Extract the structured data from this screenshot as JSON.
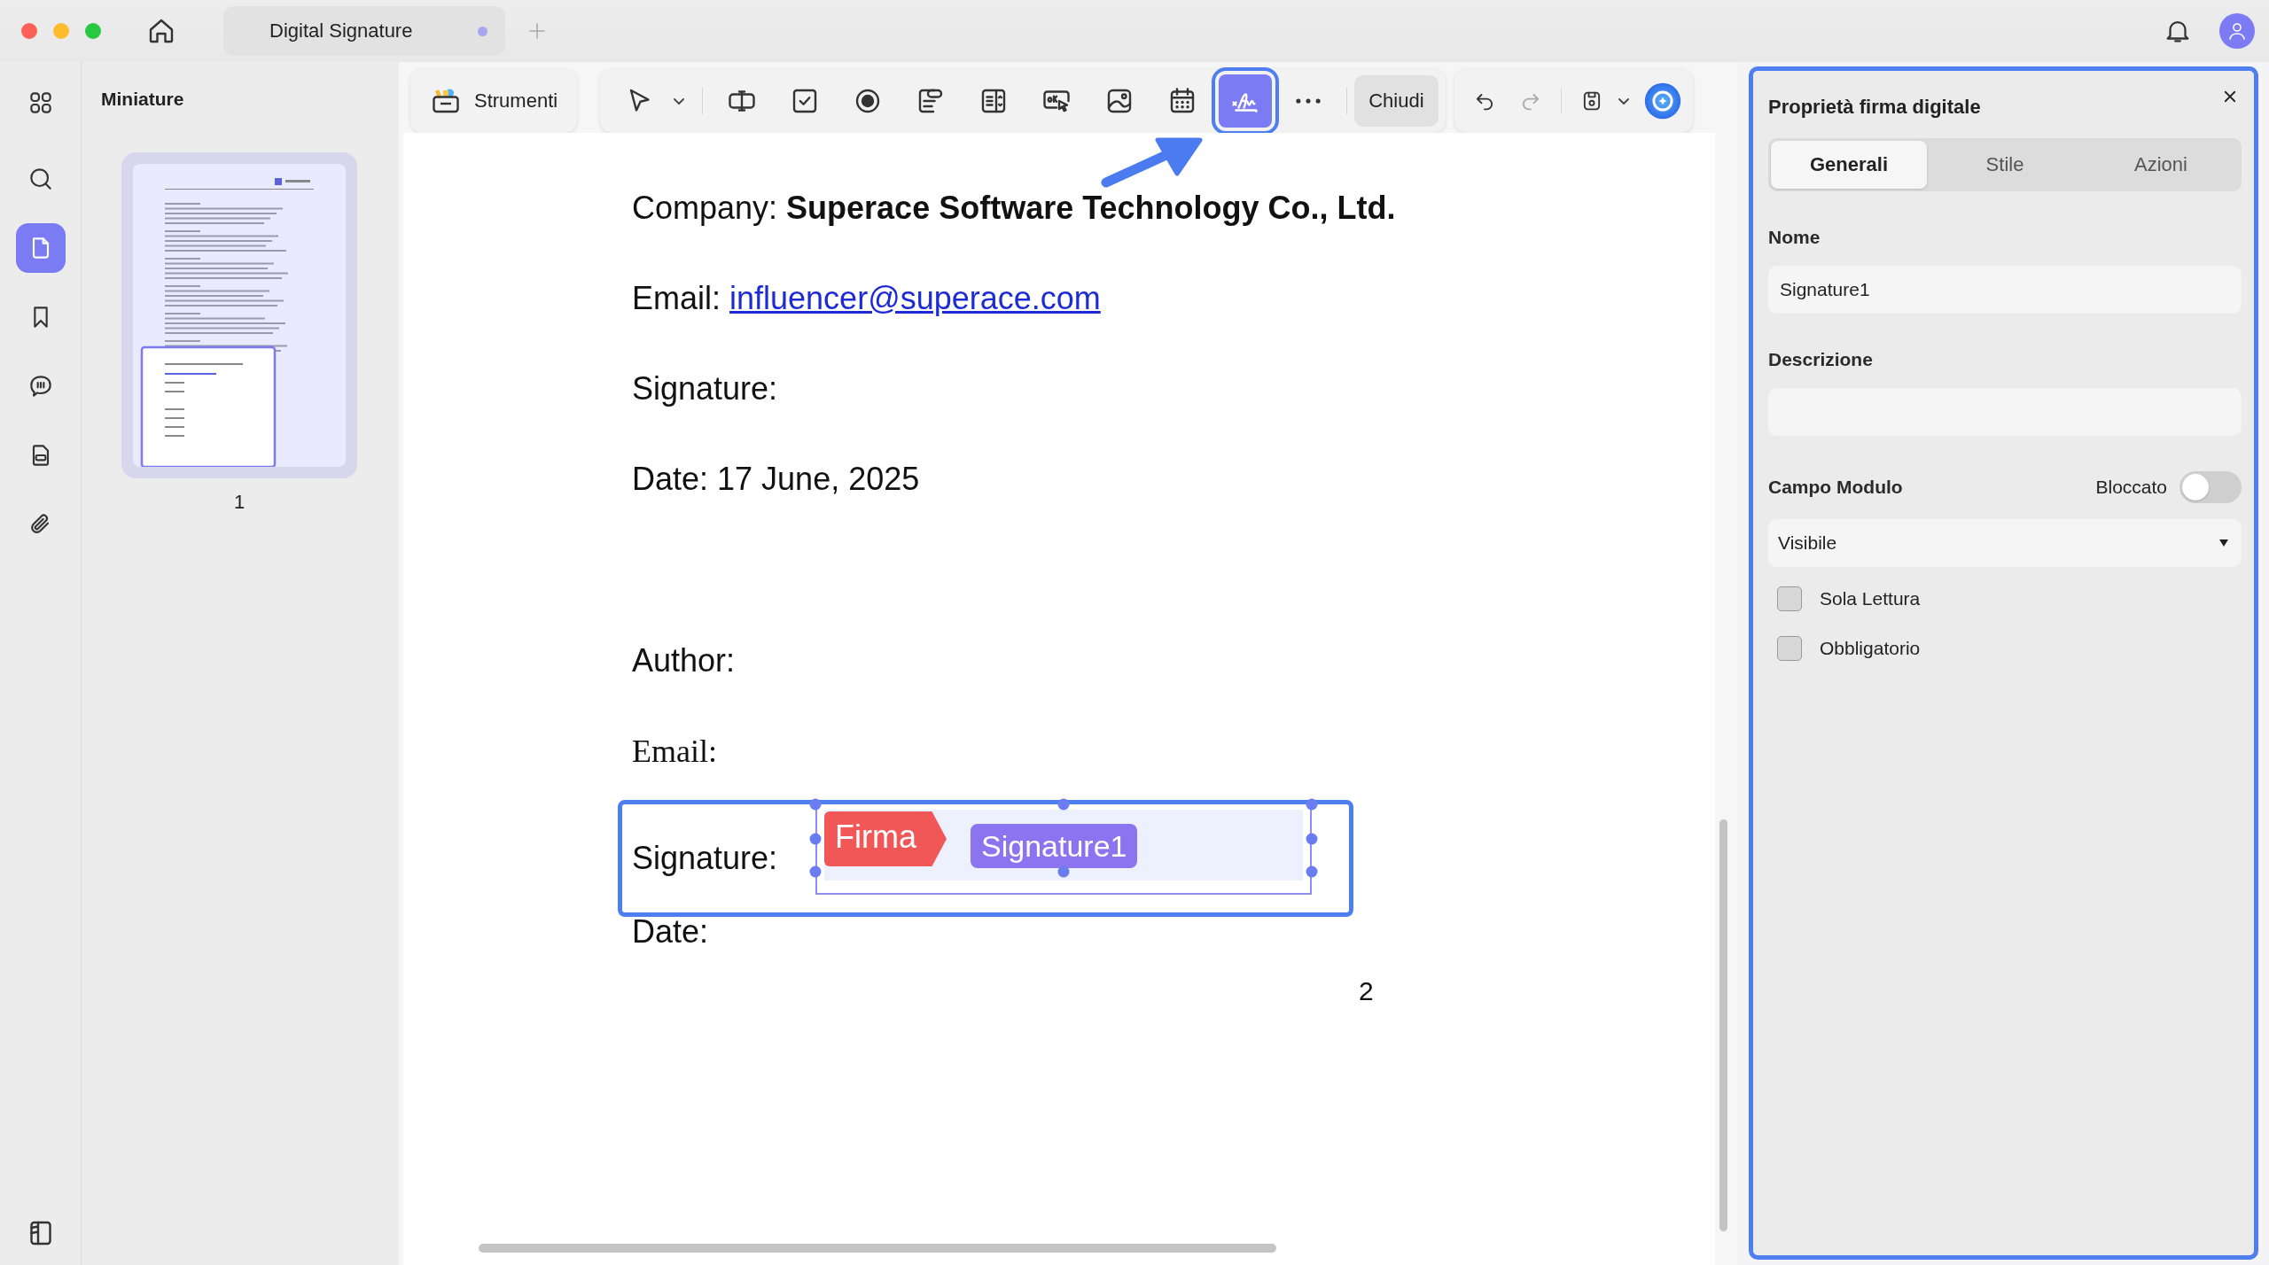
{
  "window": {
    "tab_title": "Digital Signature",
    "tab_unsaved": true
  },
  "rail": {
    "items": [
      {
        "kind": "grid",
        "selected": false
      },
      {
        "kind": "search",
        "selected": false
      },
      {
        "kind": "page",
        "selected": true
      },
      {
        "kind": "bookmark",
        "selected": false
      },
      {
        "kind": "comment",
        "selected": false
      },
      {
        "kind": "form",
        "selected": false
      },
      {
        "kind": "attachment",
        "selected": false
      }
    ]
  },
  "thumbnails": {
    "title": "Miniature",
    "pages": [
      {
        "label": "1",
        "selected": true
      }
    ]
  },
  "toolbar": {
    "tools_button": "Strumenti",
    "tools": [
      {
        "kind": "pointer",
        "selected": false
      },
      {
        "kind": "text-field",
        "selected": false
      },
      {
        "kind": "checkbox",
        "selected": false
      },
      {
        "kind": "radio",
        "selected": false
      },
      {
        "kind": "combo",
        "selected": false
      },
      {
        "kind": "list",
        "selected": false
      },
      {
        "kind": "button",
        "selected": false
      },
      {
        "kind": "image",
        "selected": false
      },
      {
        "kind": "date",
        "selected": false
      },
      {
        "kind": "signature",
        "selected": true
      }
    ],
    "close_button": "Chiudi",
    "history": [
      {
        "kind": "undo",
        "disabled": false
      },
      {
        "kind": "redo",
        "disabled": true
      }
    ]
  },
  "document": {
    "blocks": [
      {
        "lines": [
          {
            "kind": "bold",
            "label": "Company:",
            "value": "Superace Software Technology Co., Ltd."
          },
          {
            "kind": "link",
            "label": "Email:",
            "value": "influencer@superace.com"
          },
          {
            "kind": "plain",
            "label": "Signature:"
          },
          {
            "kind": "plain",
            "label": "Date: 17 June, 2025"
          }
        ]
      },
      {
        "lines": [
          {
            "kind": "plain",
            "label": "Author:"
          },
          {
            "kind": "serif",
            "label": "Email:"
          },
          {
            "kind": "signature-field",
            "label": "Signature:",
            "tag": "Firma",
            "name": "Signature1"
          },
          {
            "kind": "plain",
            "label": "Date:"
          }
        ]
      }
    ],
    "page_number": "2"
  },
  "properties": {
    "title": "Proprietà firma digitale",
    "tabs": [
      {
        "label": "Generali",
        "selected": true
      },
      {
        "label": "Stile",
        "selected": false
      },
      {
        "label": "Azioni",
        "selected": false
      }
    ],
    "name_label": "Nome",
    "name_value": "Signature1",
    "description_label": "Descrizione",
    "form_field_label": "Campo Modulo",
    "locked_label": "Bloccato",
    "locked": false,
    "visibility": "Visibile",
    "options": [
      {
        "label": "Sola Lettura",
        "checked": false
      },
      {
        "label": "Obbligatorio",
        "checked": false
      }
    ]
  }
}
